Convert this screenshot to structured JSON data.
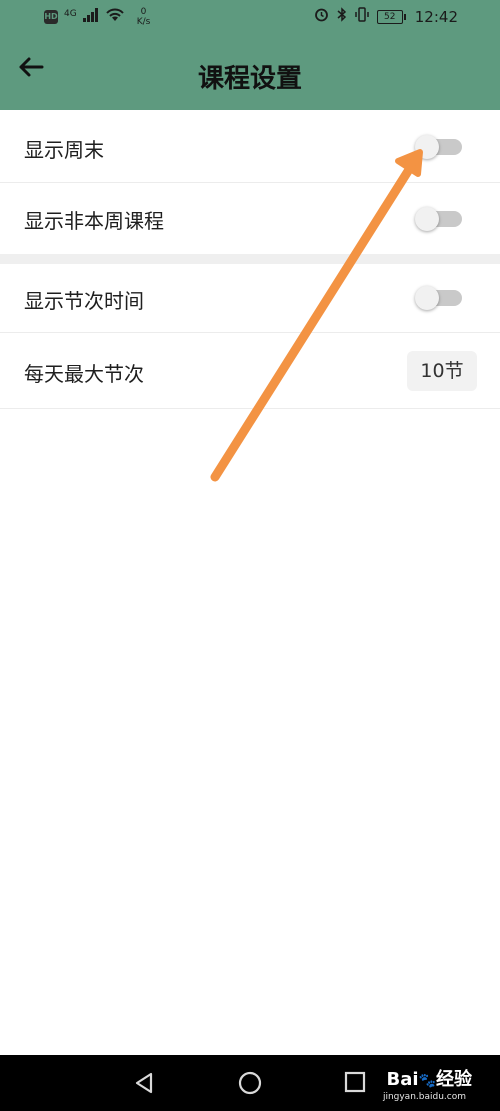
{
  "status_bar": {
    "hd_badge": "HD",
    "network": "4G",
    "speed_value": "0",
    "speed_unit": "K/s",
    "battery": "52",
    "time": "12:42"
  },
  "header": {
    "title": "课程设置",
    "back_icon": "arrow-left-icon",
    "color": "#5e9a7f"
  },
  "settings": [
    {
      "label": "显示周末",
      "type": "toggle",
      "checked": false
    },
    {
      "label": "显示非本周课程",
      "type": "toggle",
      "checked": false
    },
    {
      "label": "显示节次时间",
      "type": "toggle",
      "checked": false
    },
    {
      "label": "每天最大节次",
      "type": "value",
      "value": "10节"
    }
  ],
  "annotation": {
    "arrow_color": "#f39343"
  },
  "nav_bar": {
    "buttons": [
      "back-triangle-icon",
      "home-circle-icon",
      "recents-square-icon"
    ]
  },
  "watermark": {
    "brand": "Bai",
    "brand2": "经验",
    "url": "jingyan.baidu.com"
  }
}
